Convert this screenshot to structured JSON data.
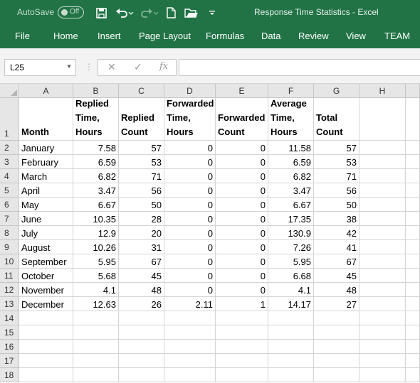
{
  "titlebar": {
    "autosave_label": "AutoSave",
    "autosave_state": "Off",
    "window_title": "Response Time Statistics  -  Excel",
    "accent_color": "#217346"
  },
  "ribbon": {
    "tabs": [
      "File",
      "Home",
      "Insert",
      "Page Layout",
      "Formulas",
      "Data",
      "Review",
      "View",
      "TEAM"
    ]
  },
  "formula_bar": {
    "name_box": "L25",
    "fx_label": "fx",
    "formula": ""
  },
  "sheet": {
    "column_letters": [
      "A",
      "B",
      "C",
      "D",
      "E",
      "F",
      "G",
      "H"
    ],
    "row_numbers": [
      "1",
      "2",
      "3",
      "4",
      "5",
      "6",
      "7",
      "8",
      "9",
      "10",
      "11",
      "12",
      "13",
      "14",
      "15",
      "16",
      "17",
      "18"
    ],
    "headers": [
      "Month",
      "Replied\nTime,\nHours",
      "Replied\nCount",
      "Forwarded\nTime,\nHours",
      "Forwarded\nCount",
      "Average\nTime,\nHours",
      "Total\nCount"
    ],
    "rows": [
      [
        "January",
        "7.58",
        "57",
        "0",
        "0",
        "11.58",
        "57"
      ],
      [
        "February",
        "6.59",
        "53",
        "0",
        "0",
        "6.59",
        "53"
      ],
      [
        "March",
        "6.82",
        "71",
        "0",
        "0",
        "6.82",
        "71"
      ],
      [
        "April",
        "3.47",
        "56",
        "0",
        "0",
        "3.47",
        "56"
      ],
      [
        "May",
        "6.67",
        "50",
        "0",
        "0",
        "6.67",
        "50"
      ],
      [
        "June",
        "10.35",
        "28",
        "0",
        "0",
        "17.35",
        "38"
      ],
      [
        "July",
        "12.9",
        "20",
        "0",
        "0",
        "130.9",
        "42"
      ],
      [
        "August",
        "10.26",
        "31",
        "0",
        "0",
        "7.26",
        "41"
      ],
      [
        "September",
        "5.95",
        "67",
        "0",
        "0",
        "5.95",
        "67"
      ],
      [
        "October",
        "5.68",
        "45",
        "0",
        "0",
        "6.68",
        "45"
      ],
      [
        "November",
        "4.1",
        "48",
        "0",
        "0",
        "4.1",
        "48"
      ],
      [
        "December",
        "12.63",
        "26",
        "2.11",
        "1",
        "14.17",
        "27"
      ]
    ]
  }
}
